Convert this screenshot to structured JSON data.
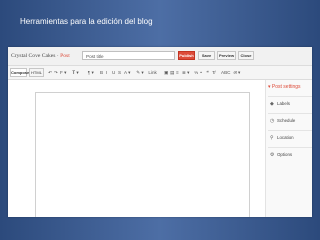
{
  "slide": {
    "title": "Herramientas para la edición del blog"
  },
  "editor_ui": {
    "blog_name": "Crystal Cove Cakes",
    "separator": " · ",
    "post_label": "Post",
    "title_value": "Post title",
    "buttons": {
      "publish": "Publish",
      "save": "Save",
      "preview": "Preview",
      "close": "Close"
    },
    "modes": {
      "compose": "Compose",
      "html": "HTML"
    },
    "toolbar_tools": [
      {
        "name": "undo-icon",
        "glyph": "↶"
      },
      {
        "name": "redo-icon",
        "glyph": "↷"
      },
      {
        "name": "font-dropdown",
        "glyph": "F ▾"
      },
      {
        "name": "font-size-dropdown",
        "glyph": "𝐓 ▾"
      },
      {
        "name": "format-dropdown",
        "glyph": "¶ ▾"
      },
      {
        "name": "bold-icon",
        "glyph": "B"
      },
      {
        "name": "italic-icon",
        "glyph": "I"
      },
      {
        "name": "underline-icon",
        "glyph": "U"
      },
      {
        "name": "strikethrough-icon",
        "glyph": "S"
      },
      {
        "name": "text-color-icon",
        "glyph": "A ▾"
      },
      {
        "name": "highlight-icon",
        "glyph": "✎ ▾"
      },
      {
        "name": "link-icon",
        "glyph": "Link"
      },
      {
        "name": "image-icon",
        "glyph": "▣"
      },
      {
        "name": "video-icon",
        "glyph": "▤"
      },
      {
        "name": "jump-break-icon",
        "glyph": "≡"
      },
      {
        "name": "align-icon",
        "glyph": "≣ ▾"
      },
      {
        "name": "numbered-list-icon",
        "glyph": "⅓"
      },
      {
        "name": "bullet-list-icon",
        "glyph": "•"
      },
      {
        "name": "quote-icon",
        "glyph": "❝"
      },
      {
        "name": "clear-format-icon",
        "glyph": "T̸"
      },
      {
        "name": "spellcheck-icon",
        "glyph": "ABC"
      },
      {
        "name": "input-tools-icon",
        "glyph": "अ ▾"
      }
    ],
    "side_panel": {
      "header": "▾ Post settings",
      "items": [
        {
          "icon": "label-icon",
          "glyph": "◆",
          "label": "Labels"
        },
        {
          "icon": "clock-icon",
          "glyph": "◷",
          "label": "Schedule"
        },
        {
          "icon": "location-icon",
          "glyph": "⚲",
          "label": "Location"
        },
        {
          "icon": "gear-icon",
          "glyph": "⚙",
          "label": "Options"
        }
      ]
    },
    "resize_glyph": "◢",
    "colors": {
      "accent": "#dd4b39",
      "slide_background": "#3a5a8f"
    }
  }
}
